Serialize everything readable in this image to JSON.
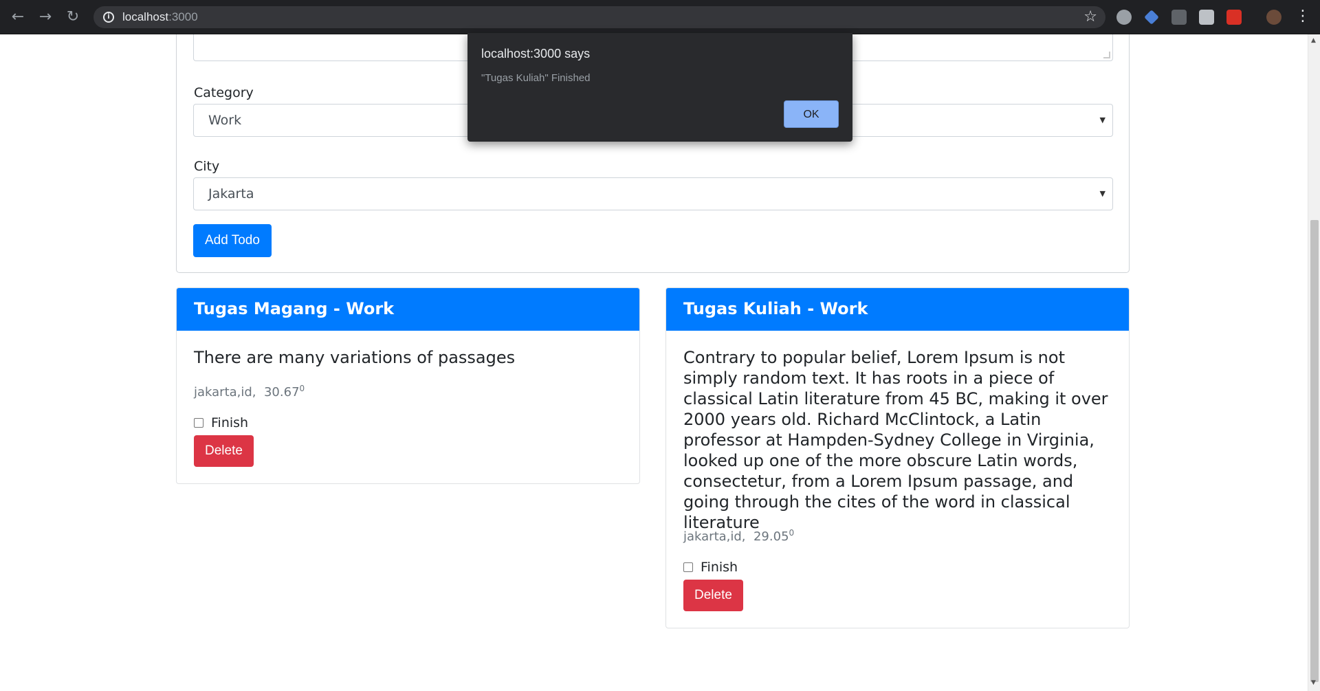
{
  "browser": {
    "url_host": "localhost",
    "url_port": ":3000",
    "back_icon": "arrow-left-icon",
    "forward_icon": "arrow-right-icon",
    "reload_icon": "reload-icon",
    "star_icon": "star-icon"
  },
  "form": {
    "category_label": "Category",
    "category_value": "Work",
    "city_label": "City",
    "city_value": "Jakarta",
    "add_button": "Add Todo"
  },
  "todos": [
    {
      "title": "Tugas Magang - Work",
      "description": "There are many variations of passages",
      "location": "jakarta,id,",
      "temperature": "30.67",
      "degree": "0",
      "finish_label": "Finish",
      "delete_label": "Delete"
    },
    {
      "title": "Tugas Kuliah - Work",
      "description": "Contrary to popular belief, Lorem Ipsum is not simply random text. It has roots in a piece of classical Latin literature from 45 BC, making it over 2000 years old. Richard McClintock, a Latin professor at Hampden-Sydney College in Virginia, looked up one of the more obscure Latin words, consectetur, from a Lorem Ipsum passage, and going through the cites of the word in classical literature",
      "location": "jakarta,id,",
      "temperature": "29.05",
      "degree": "0",
      "finish_label": "Finish",
      "delete_label": "Delete"
    }
  ],
  "dialog": {
    "title": "localhost:3000 says",
    "message": "\"Tugas Kuliah\" Finished",
    "ok_label": "OK"
  },
  "colors": {
    "primary": "#007bff",
    "danger": "#dc3545",
    "dialog_bg": "#292a2d",
    "dialog_button": "#8ab4f8"
  }
}
